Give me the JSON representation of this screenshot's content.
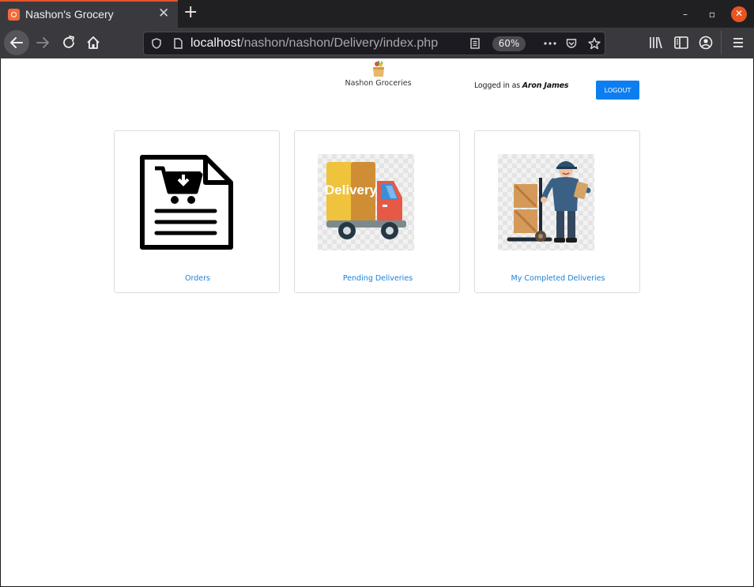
{
  "browser": {
    "tab_title": "Nashon's Grocery",
    "tab_close": "✕",
    "new_tab": "+",
    "url_host": "localhost",
    "url_path": "/nashon/nashon/Delivery/index.php",
    "zoom": "60%",
    "window_controls": {
      "minimize": "–",
      "maximize": "▫",
      "close": "✕"
    }
  },
  "header": {
    "brand_name": "Nashon Groceries",
    "logged_in_prefix": "Logged in as ",
    "user_name": "Aron James",
    "logout_label": "LOGOUT"
  },
  "cards": [
    {
      "label": "Orders",
      "icon": "cart-document-icon"
    },
    {
      "label": "Pending Deliveries",
      "icon": "delivery-truck-icon"
    },
    {
      "label": "My Completed Deliveries",
      "icon": "delivery-man-icon"
    }
  ],
  "colors": {
    "accent": "#0d7ef0",
    "link": "#1a82d8",
    "tab_highlight": "#e2532d"
  }
}
